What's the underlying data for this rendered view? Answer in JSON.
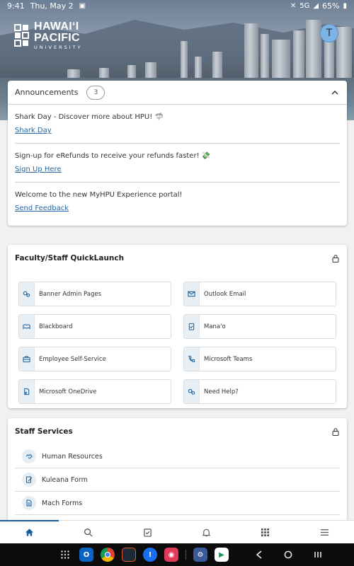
{
  "status_bar": {
    "time": "9:41",
    "date": "Thu, May 2",
    "network": "5G",
    "battery": "65%"
  },
  "header": {
    "logo_line1": "HAWAIʻI",
    "logo_line2": "PACIFIC",
    "logo_line3": "UNIVERSITY",
    "avatar_initial": "T"
  },
  "announcements": {
    "title": "Announcements",
    "count": "3",
    "items": [
      {
        "text": "Shark Day - Discover more about HPU! 🦈",
        "link": "Shark Day"
      },
      {
        "text": "Sign-up for eRefunds to receive your refunds faster! 💸",
        "link": "Sign Up Here"
      },
      {
        "text": "Welcome to the new MyHPU Experience portal!",
        "link": "Send Feedback"
      }
    ]
  },
  "quicklaunch": {
    "title": "Faculty/Staff QuickLaunch",
    "tiles": [
      {
        "label": "Banner Admin Pages",
        "icon": "gears-icon"
      },
      {
        "label": "Outlook Email",
        "icon": "envelope-icon"
      },
      {
        "label": "Blackboard",
        "icon": "chalkboard-icon"
      },
      {
        "label": "Mana'o",
        "icon": "clipboard-check-icon"
      },
      {
        "label": "Employee Self-Service",
        "icon": "briefcase-icon"
      },
      {
        "label": "Microsoft Teams",
        "icon": "phone-icon"
      },
      {
        "label": "Microsoft OneDrive",
        "icon": "cloud-file-icon"
      },
      {
        "label": "Need Help?",
        "icon": "gears-icon"
      }
    ]
  },
  "staff_services": {
    "title": "Staff Services",
    "items": [
      {
        "label": "Human Resources",
        "icon": "handshake-icon"
      },
      {
        "label": "Kuleana Form",
        "icon": "signature-icon"
      },
      {
        "label": "Mach Forms",
        "icon": "document-icon"
      }
    ]
  },
  "bottom_nav": [
    "home-icon",
    "search-icon",
    "tasks-icon",
    "bell-icon",
    "apps-grid-icon",
    "menu-icon"
  ],
  "colors": {
    "accent": "#1a5f99",
    "link": "#2566a0",
    "icon_bg": "#e8f0f6"
  }
}
